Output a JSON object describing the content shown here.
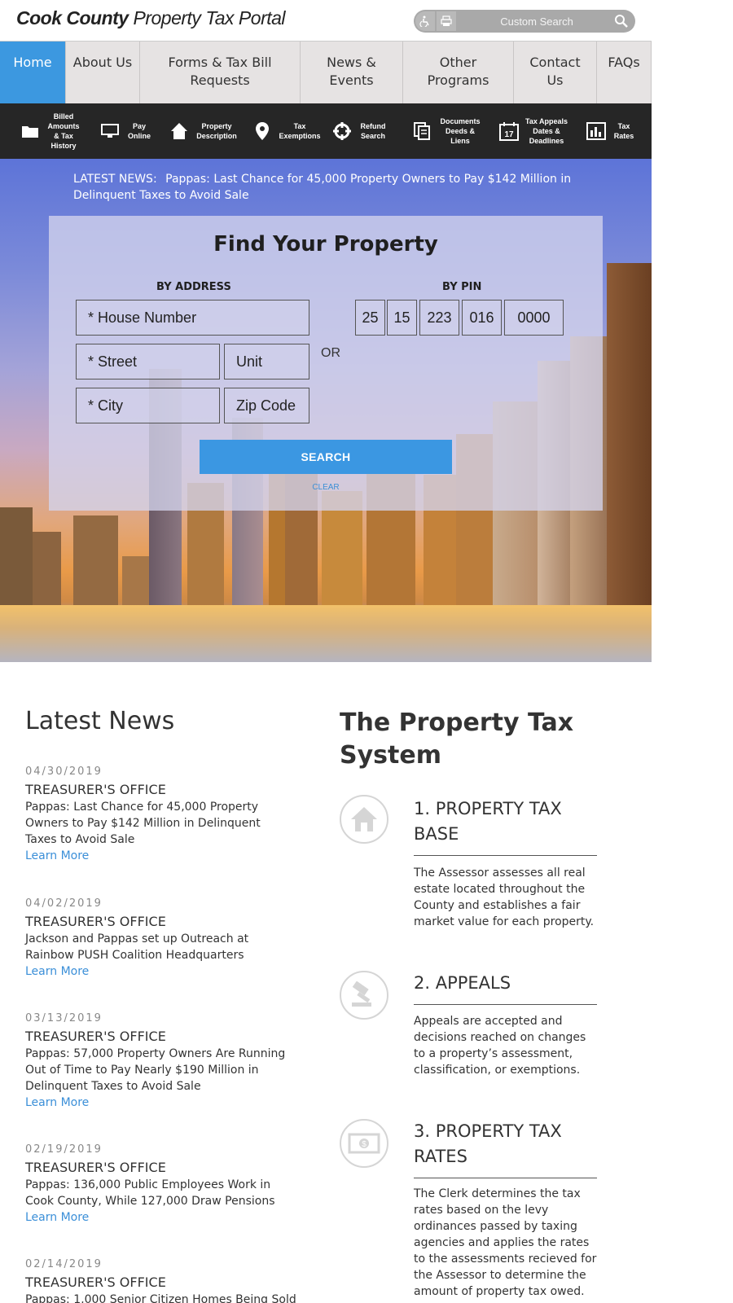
{
  "header": {
    "logo_bold": "Cook County",
    "logo_light": "Property Tax Portal",
    "search_placeholder": "Custom Search"
  },
  "nav": [
    "Home",
    "About Us",
    "Forms & Tax Bill Requests",
    "News & Events",
    "Other Programs",
    "Contact Us",
    "FAQs"
  ],
  "quick_links": [
    {
      "label": "Billed Amounts & Tax History",
      "icon": "folder-icon"
    },
    {
      "label": "Pay Online",
      "icon": "monitor-icon"
    },
    {
      "label": "Property Description",
      "icon": "house-icon"
    },
    {
      "label": "Tax Exemptions",
      "icon": "map-pin-icon"
    },
    {
      "label": "Refund Search",
      "icon": "crosshair-icon"
    },
    {
      "label": "Documents Deeds & Liens",
      "icon": "documents-icon"
    },
    {
      "label": "Tax Appeals Dates & Deadlines",
      "icon": "calendar-icon"
    },
    {
      "label": "Tax Rates",
      "icon": "bar-chart-icon"
    }
  ],
  "hero": {
    "news_tag": "LATEST NEWS:",
    "news_text": "Pappas: Last Chance for 45,000 Property Owners to Pay $142 Million in Delinquent Taxes to Avoid Sale"
  },
  "finder": {
    "title": "Find Your Property",
    "by_address": "BY ADDRESS",
    "by_pin": "BY PIN",
    "house_number": "* House Number",
    "street": "* Street",
    "unit": "Unit",
    "city": "* City",
    "zip": "Zip Code",
    "or": "OR",
    "pin": [
      "25",
      "15",
      "223",
      "016",
      "0000"
    ],
    "search": "SEARCH",
    "clear": "CLEAR",
    "calendar_num": "17"
  },
  "latest_news": {
    "heading": "Latest News",
    "items": [
      {
        "date": "04/30/2019",
        "office": "TREASURER'S OFFICE",
        "title": "Pappas: Last Chance for 45,000 Property Owners to Pay $142 Million in Delinquent Taxes to Avoid Sale",
        "link": "Learn More"
      },
      {
        "date": "04/02/2019",
        "office": "TREASURER'S OFFICE",
        "title": "Jackson and Pappas set up Outreach at Rainbow PUSH Coalition Headquarters",
        "link": "Learn More"
      },
      {
        "date": "03/13/2019",
        "office": "TREASURER'S OFFICE",
        "title": "Pappas: 57,000 Property Owners Are Running Out of Time to Pay Nearly $190 Million in Delinquent Taxes to Avoid Sale",
        "link": "Learn More"
      },
      {
        "date": "02/19/2019",
        "office": "TREASURER'S OFFICE",
        "title": "Pappas: 136,000 Public Employees Work in Cook County, While 127,000 Draw Pensions",
        "link": "Learn More"
      },
      {
        "date": "02/14/2019",
        "office": "TREASURER'S OFFICE",
        "title": "Pappas: 1,000 Senior Citizen Homes Being Sold",
        "link": ""
      }
    ]
  },
  "tax_system": {
    "heading": "The Property Tax System",
    "steps": [
      {
        "title": "1. PROPERTY TAX BASE",
        "desc": "The Assessor assesses all real estate located throughout the County and establishes a fair market value for each property.",
        "icon": "house-icon"
      },
      {
        "title": "2. APPEALS",
        "desc": "Appeals are accepted and decisions reached on changes to a property’s assessment, classification, or exemptions.",
        "icon": "gavel-icon"
      },
      {
        "title": "3. PROPERTY TAX RATES",
        "desc": "The Clerk determines the tax rates based on the levy ordinances passed by taxing agencies and applies the rates to the assessments recieved for the Assessor to determine the amount of property tax owed.",
        "icon": "money-icon"
      }
    ]
  },
  "colors": {
    "accent": "#3c98e0",
    "dark_bar": "#262626",
    "nav_bg": "#e6e3e3"
  }
}
